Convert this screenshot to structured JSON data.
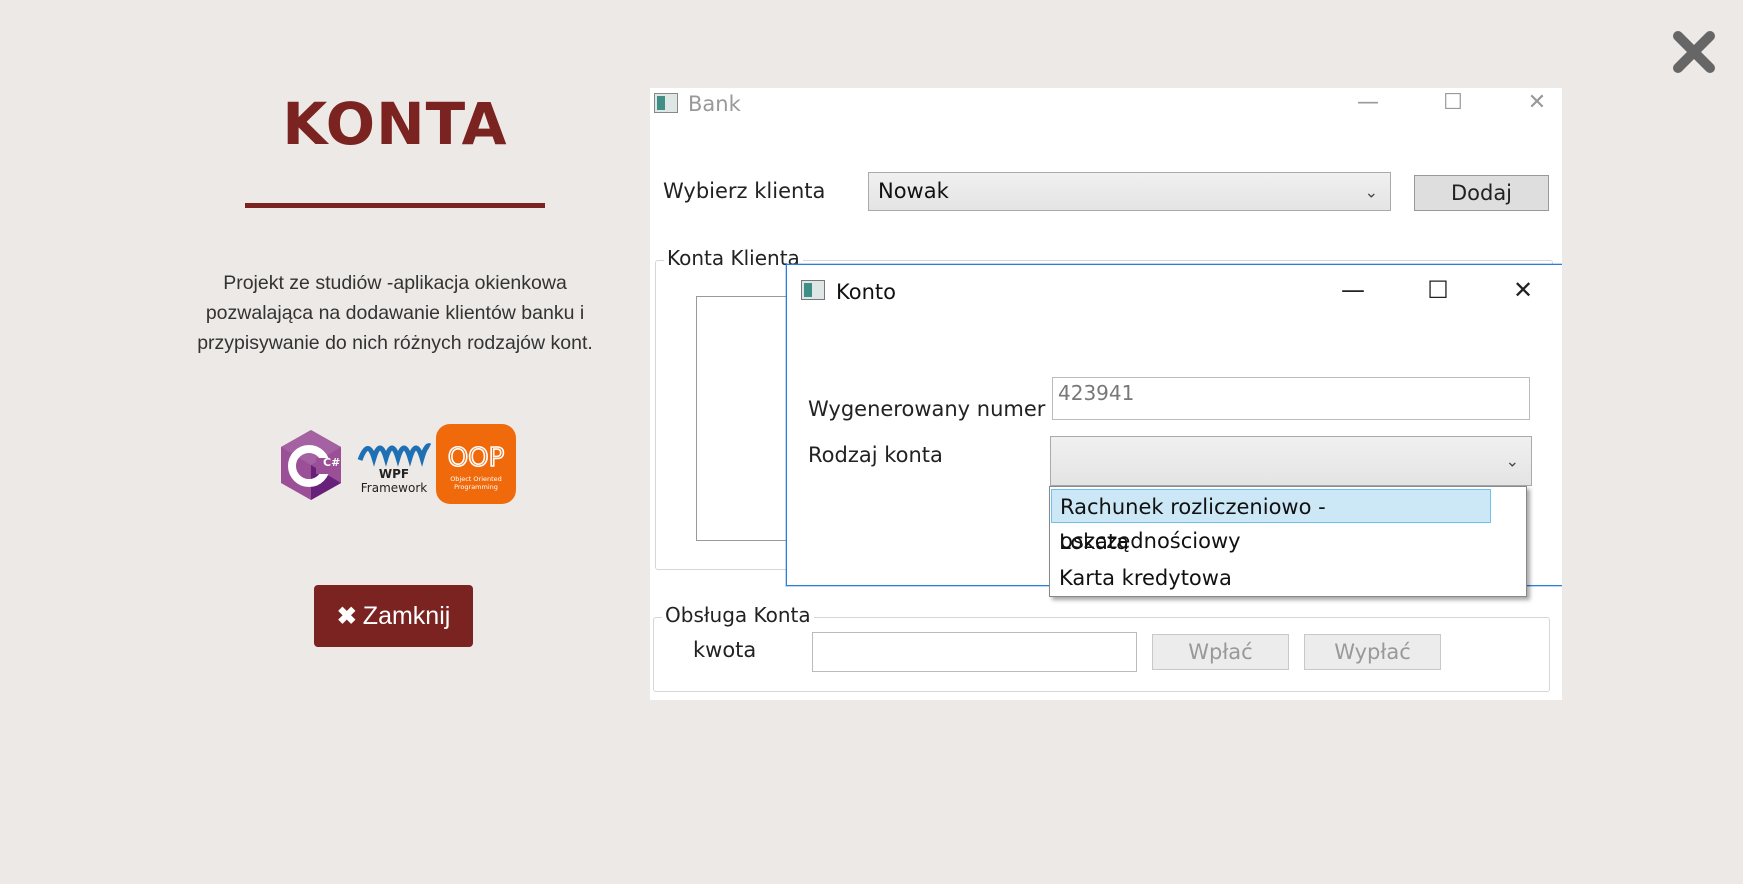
{
  "page": {
    "title": "KONTA",
    "description_lines": [
      "Projekt ze studiów -aplikacja okienkowa",
      "pozwalająca na dodawanie klientów banku i",
      "przypisywanie do nich różnych rodzajów kont."
    ],
    "close_button_label": "Zamknij",
    "accent_color": "#7b2320",
    "logos": [
      {
        "name": "csharp-logo",
        "text": "C#"
      },
      {
        "name": "wpf-logo",
        "text": "WPF Framework"
      },
      {
        "name": "oop-logo",
        "text": "OOP",
        "subtext": "Object Oriented Programming"
      }
    ]
  },
  "bank_window": {
    "title": "Bank",
    "client_label": "Wybierz klienta",
    "client_value": "Nowak",
    "add_button": "Dodaj",
    "accounts_group": "Konta Klienta",
    "service_group": "Obsługa Konta",
    "amount_label": "kwota",
    "deposit_button": "Wpłać",
    "withdraw_button": "Wypłać"
  },
  "account_dialog": {
    "title": "Konto",
    "number_label": "Wygenerowany numer",
    "number_value": "423941",
    "type_label": "Rodzaj konta",
    "type_options": [
      "Rachunek rozliczeniowo - oszczędnościowy",
      "Lokata",
      "Karta kredytowa"
    ],
    "highlighted_option": "Rachunek rozliczeniowo - oszczędnościowy"
  }
}
